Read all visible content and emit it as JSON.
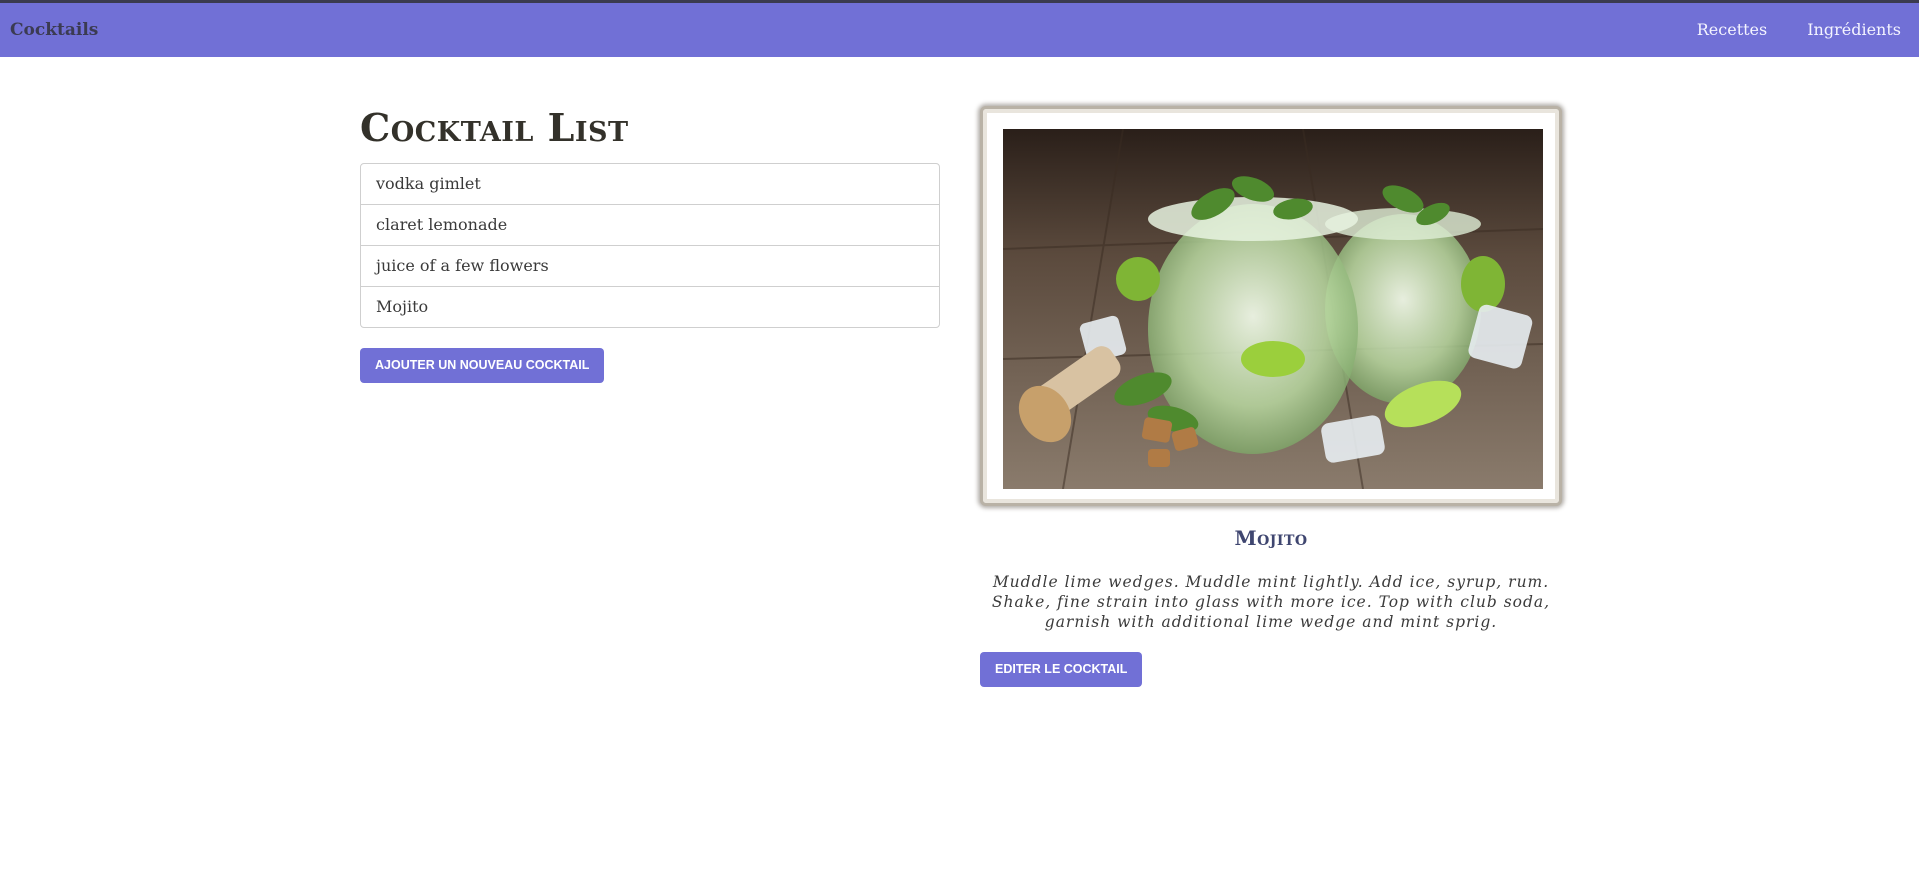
{
  "navbar": {
    "brand": "Cocktails",
    "links": [
      "Recettes",
      "Ingrédients"
    ]
  },
  "list": {
    "title": "Cocktail List",
    "items": [
      "vodka gimlet",
      "claret lemonade",
      "juice of a few flowers",
      "Mojito"
    ],
    "add_button": "Ajouter un nouveau cocktail"
  },
  "detail": {
    "image_subject": "mojito glasses with mint and lime",
    "name": "Mojito",
    "description": "Muddle lime wedges. Muddle mint lightly. Add ice, syrup, rum. Shake, fine strain into glass with more ice. Top with club soda, garnish with additional lime wedge and mint sprig.",
    "edit_button": "Editer le cocktail"
  },
  "colors": {
    "accent": "#7170d6",
    "top_line": "#3b3b4f",
    "title_dark": "#33312a",
    "cocktail_name": "#3f4670"
  }
}
